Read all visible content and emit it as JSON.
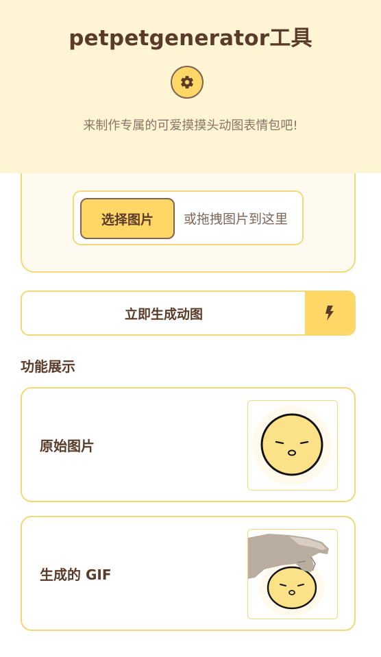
{
  "header": {
    "title": "petpetgenerator工具",
    "settings_icon": "gear-icon",
    "subtitle": "来制作专属的可爱摸摸头动图表情包吧!"
  },
  "upload": {
    "choose_label": "选择图片",
    "drop_hint": "或拖拽图片到这里"
  },
  "generate": {
    "label": "立即生成动图",
    "icon": "lightning-bolt-icon"
  },
  "showcase": {
    "title": "功能展示",
    "items": [
      {
        "label": "原始图片",
        "image": "sleepy-face-image"
      },
      {
        "label": "生成的 GIF",
        "image": "hand-petting-face-gif"
      }
    ]
  },
  "colors": {
    "header_bg": "#fff4d3",
    "accent": "#ffd767",
    "border": "#f3d877",
    "text": "#5a3b2a"
  }
}
